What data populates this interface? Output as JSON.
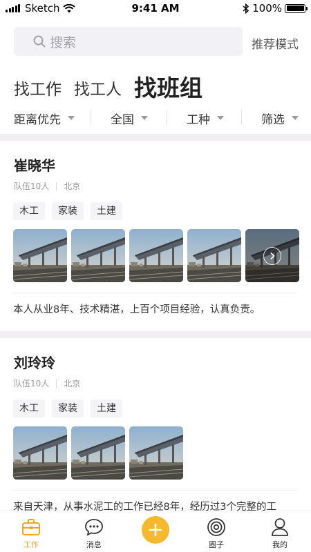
{
  "status_bar": {
    "carrier": "Sketch",
    "time": "9:41 AM",
    "battery": "100%",
    "battery_level": 1.0
  },
  "search": {
    "placeholder": "搜索",
    "mode_link": "推荐模式"
  },
  "tabs": [
    {
      "label": "找工作",
      "active": false
    },
    {
      "label": "找工人",
      "active": false
    },
    {
      "label": "找班组",
      "active": true
    }
  ],
  "filters": [
    {
      "label": "距离优先"
    },
    {
      "label": "全国"
    },
    {
      "label": "工种"
    },
    {
      "label": "筛选"
    }
  ],
  "cards": [
    {
      "name": "崔晓华",
      "team": "队伍10人",
      "city": "北京",
      "tags": [
        "木工",
        "家装",
        "土建"
      ],
      "photo_count": 5,
      "has_more": true,
      "description": "本人从业8年、技术精湛，上百个项目经验，认真负责。"
    },
    {
      "name": "刘玲玲",
      "team": "队伍10人",
      "city": "北京",
      "tags": [
        "木工",
        "家装",
        "土建"
      ],
      "photo_count": 3,
      "has_more": false,
      "description": "来自天津，从事水泥工的工作已经8年，经历过3个完整的工"
    }
  ],
  "tabbar": {
    "items": [
      {
        "label": "工作",
        "icon": "toolbox-icon",
        "active": true
      },
      {
        "label": "消息",
        "icon": "chat-bubble-icon",
        "active": false
      },
      {
        "label": "圈子",
        "icon": "circle-icon",
        "active": false
      },
      {
        "label": "我的",
        "icon": "user-icon",
        "active": false
      }
    ],
    "add_icon": "plus-icon"
  },
  "colors": {
    "accent": "#f3a42b",
    "plus_button": "#f6b92c",
    "divider_band": "#f2eff3"
  }
}
